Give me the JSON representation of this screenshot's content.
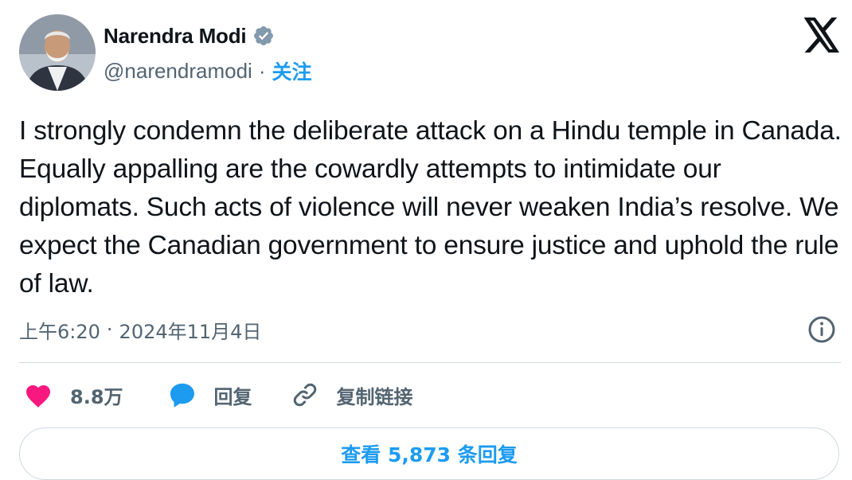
{
  "author": {
    "display_name": "Narendra Modi",
    "handle": "@narendramodi",
    "separator": "·",
    "follow_label": "关注",
    "verified": true,
    "avatar_icon": "avatar-photo"
  },
  "header": {
    "logo_icon": "x-logo-icon"
  },
  "tweet": {
    "text": "I strongly condemn the deliberate attack on a Hindu temple in Canada. Equally appalling are the cowardly attempts to intimidate our diplomats. Such acts of violence will never weaken India’s resolve. We expect the Canadian government to ensure justice and uphold the rule of law.",
    "time": "上午6:20",
    "separator": "·",
    "date": "2024年11月4日",
    "info_icon": "info-icon"
  },
  "actions": {
    "like": {
      "icon": "heart-icon",
      "count": "8.8万"
    },
    "reply": {
      "icon": "reply-bubble-icon",
      "label": "回复"
    },
    "copy_link": {
      "icon": "link-icon",
      "label": "复制链接"
    }
  },
  "footer": {
    "view_replies_label": "查看 5,873 条回复"
  },
  "colors": {
    "accent": "#1d9bf0",
    "text": "#0f1419",
    "secondary": "#536471",
    "like": "#f91880",
    "divider": "#cfd9de"
  }
}
